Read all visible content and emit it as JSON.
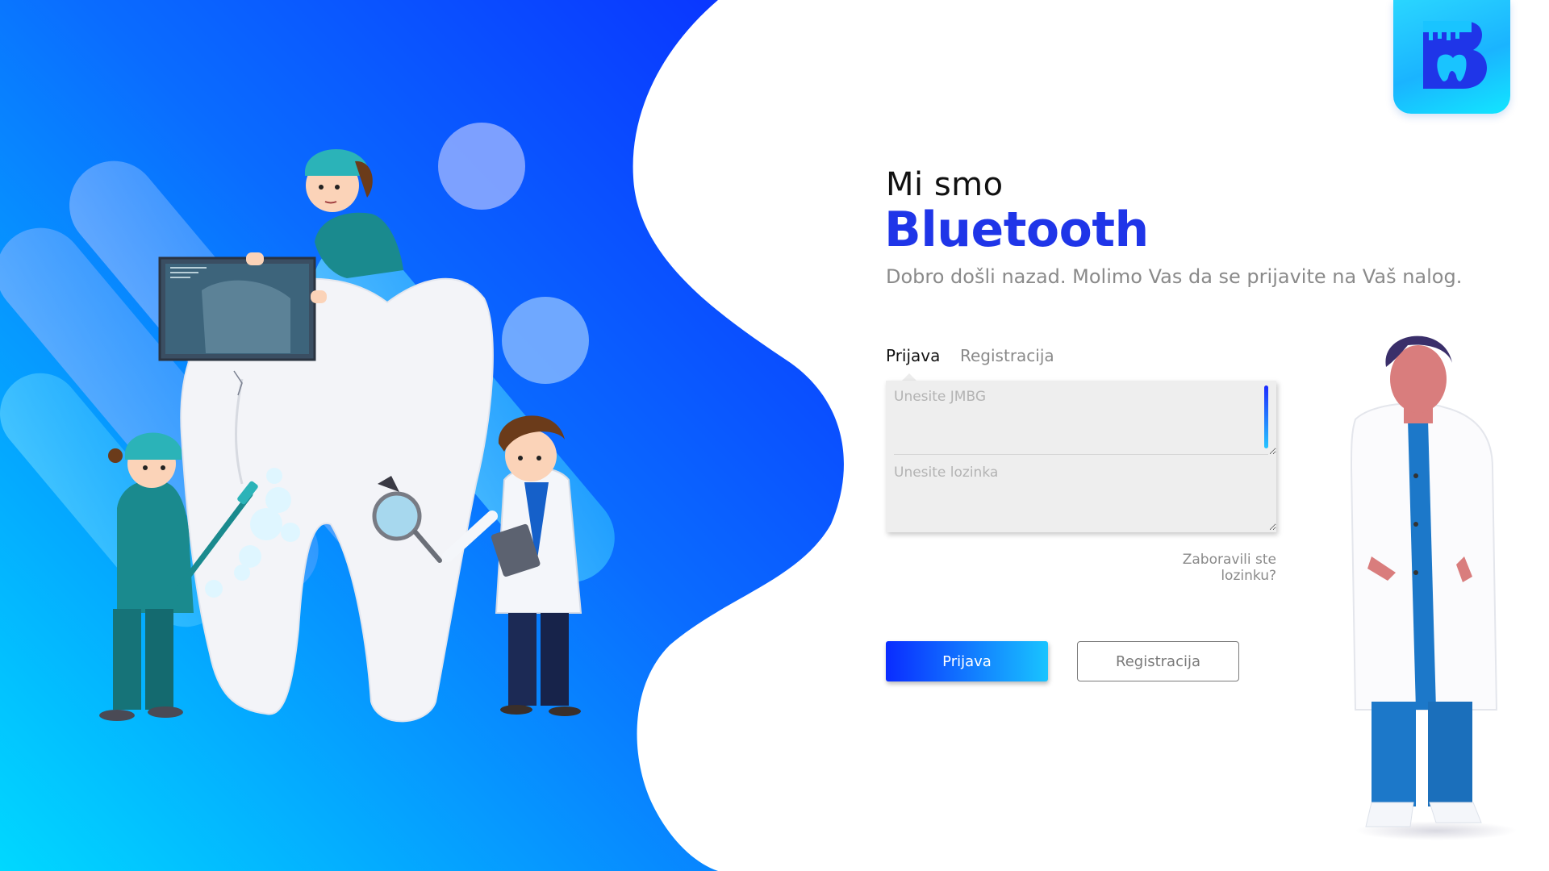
{
  "brand": {
    "logo_letter": "B",
    "logo_icon": "tooth-b-logo-icon",
    "colors": {
      "primary": "#1f35e8",
      "accent_cyan": "#19c4ff",
      "gradient_start": "#0a2cff",
      "gradient_end": "#00d8ff"
    }
  },
  "hero": {
    "greeting": "Mi smo",
    "brand_name": "Bluetooth",
    "subtitle": "Dobro došli nazad. Molimo Vas da se prijavite na Vaš nalog."
  },
  "tabs": [
    {
      "label": "Prijava",
      "active": true
    },
    {
      "label": "Registracija",
      "active": false
    }
  ],
  "form": {
    "jmbg_placeholder": "Unesite JMBG",
    "jmbg_value": "",
    "password_placeholder": "Unesite lozinka",
    "password_value": "",
    "forgot_link": "Zaboravili ste lozinku?"
  },
  "buttons": {
    "login_label": "Prijava",
    "register_label": "Registracija"
  },
  "illustrations": {
    "left": [
      "giant-tooth",
      "xray-panel",
      "dentist-with-toothbrush",
      "dentist-with-magnifier",
      "assistant-on-tooth"
    ],
    "right": [
      "doctor-in-white-coat"
    ]
  }
}
